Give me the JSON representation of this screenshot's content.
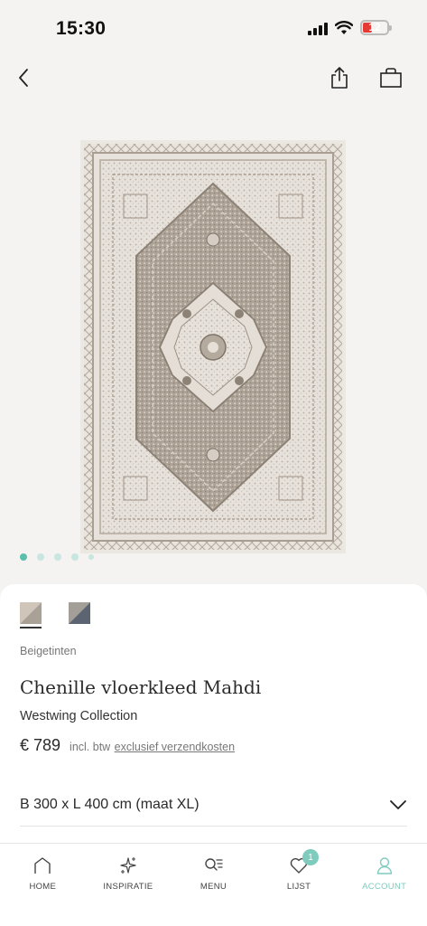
{
  "status_bar": {
    "time": "15:30",
    "battery": "12"
  },
  "product": {
    "color_name": "Beigetinten",
    "title": "Chenille vloerkleed Mahdi",
    "brand": "Westwing Collection",
    "price": "€ 789",
    "price_note": "incl. btw",
    "shipping_link": "exclusief verzendkosten",
    "size": "B 300 x L 400 cm (maat XL)"
  },
  "swatches": [
    {
      "name": "beige",
      "color": "#cfc5b8",
      "selected": true
    },
    {
      "name": "grey",
      "color": "#8b8f96",
      "selected": false
    }
  ],
  "gallery": {
    "image_count": 5,
    "active_index": 0
  },
  "colors": {
    "accent": "#5cbfae",
    "accent_light": "#7fcbbd"
  },
  "tabs": [
    {
      "label": "HOME",
      "icon": "home-icon"
    },
    {
      "label": "INSPIRATIE",
      "icon": "sparkle-icon"
    },
    {
      "label": "MENU",
      "icon": "menu-search-icon"
    },
    {
      "label": "LIJST",
      "icon": "heart-icon",
      "badge": "1"
    },
    {
      "label": "ACCOUNT",
      "icon": "user-icon",
      "active": true
    }
  ]
}
